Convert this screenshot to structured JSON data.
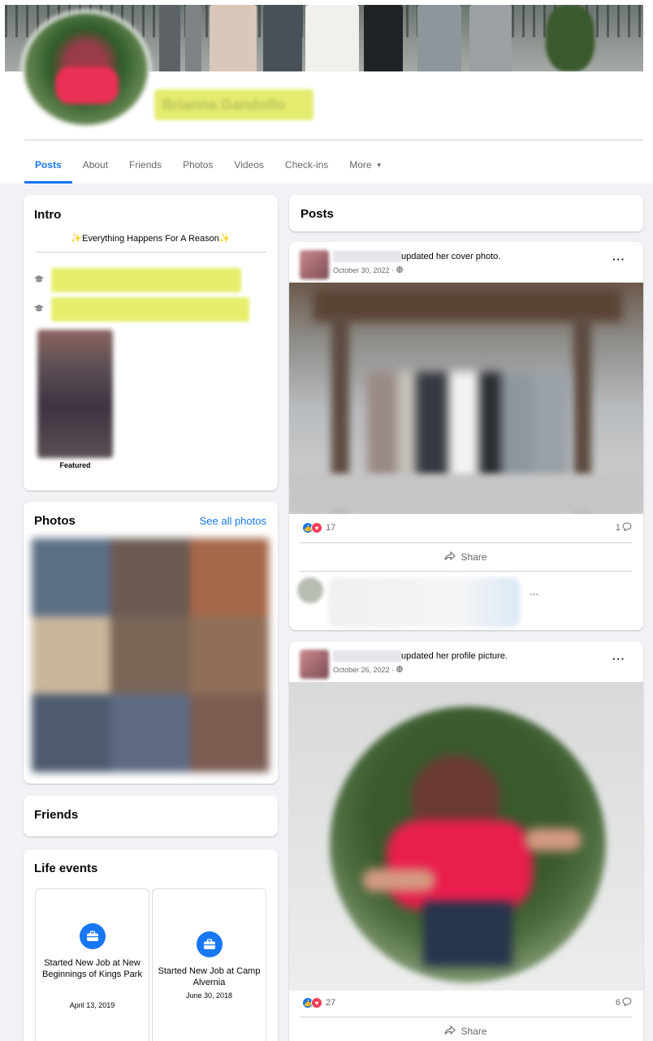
{
  "profile": {
    "name": "Brianna Gandolfo"
  },
  "tabs": [
    {
      "label": "Posts"
    },
    {
      "label": "About"
    },
    {
      "label": "Friends"
    },
    {
      "label": "Photos"
    },
    {
      "label": "Videos"
    },
    {
      "label": "Check-ins"
    },
    {
      "label": "More"
    }
  ],
  "intro": {
    "title": "Intro",
    "bio": "✨Everything Happens For A Reason✨",
    "featured_label": "Featured"
  },
  "photos": {
    "title": "Photos",
    "see_all": "See all photos"
  },
  "friends": {
    "title": "Friends"
  },
  "life_events": {
    "title": "Life events",
    "items": [
      {
        "title": "Started New Job at New Beginnings of Kings Park",
        "date": "April 13, 2019"
      },
      {
        "title": "Started New Job at Camp Alvernia",
        "date": "June 30, 2018"
      }
    ]
  },
  "posts": {
    "title": "Posts",
    "items": [
      {
        "action": "updated her cover photo.",
        "date": "October 30, 2022 · ",
        "reactions": "17",
        "comments": "1",
        "share": "Share",
        "more": "···"
      },
      {
        "action": "updated her profile picture.",
        "date": "October 26, 2022 · ",
        "reactions": "27",
        "comments": "6",
        "share": "Share",
        "more": "···"
      }
    ],
    "comment_more": "···"
  },
  "icons": {
    "education": "graduation-cap-icon",
    "life_event": "briefcase-icon",
    "like": "like-icon",
    "love": "love-icon",
    "globe": "globe-icon",
    "comment": "comment-icon",
    "share": "share-icon",
    "caret": "caret-down-icon"
  },
  "colors": {
    "accent": "#1877f2",
    "love": "#f33e58",
    "background": "#f0f2f5",
    "redaction": "#e6ef6c"
  }
}
